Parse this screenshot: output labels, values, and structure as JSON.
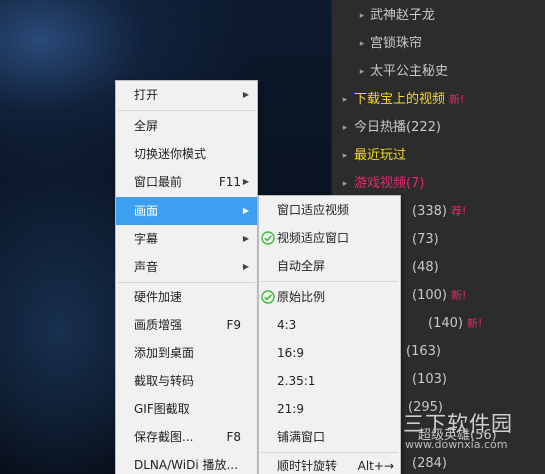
{
  "playlist": {
    "items": [
      {
        "text": "武神赵子龙",
        "badge": "",
        "style": "child"
      },
      {
        "text": "宫锁珠帘",
        "badge": "",
        "style": "child"
      },
      {
        "text": "太平公主秘史",
        "badge": "",
        "style": "child"
      },
      {
        "text": "下载宝上的视频",
        "badge": "新!",
        "style": "root-yellow"
      },
      {
        "text": "今日热播(222)",
        "badge": "",
        "style": "root-gray"
      },
      {
        "text": "最近玩过",
        "badge": "",
        "style": "root-yellow"
      },
      {
        "text": "游戏视频(7)",
        "badge": "",
        "style": "root-pink"
      },
      {
        "text": "(338)",
        "badge": "荐!",
        "style": "partial"
      },
      {
        "text": "(73)",
        "badge": "",
        "style": "partial"
      },
      {
        "text": "(48)",
        "badge": "",
        "style": "partial"
      },
      {
        "text": "(100)",
        "badge": "新!",
        "style": "partial"
      },
      {
        "text": "(140)",
        "badge": "新!",
        "style": "partial"
      },
      {
        "text": "(163)",
        "badge": "",
        "style": "partial"
      },
      {
        "text": "(103)",
        "badge": "",
        "style": "partial"
      },
      {
        "text": "(295)",
        "badge": "",
        "style": "partial"
      },
      {
        "text": "(56)",
        "badge": "",
        "style": "partial"
      },
      {
        "text": "(284)",
        "badge": "",
        "style": "partial"
      }
    ]
  },
  "main_menu": {
    "items": [
      {
        "label": "打开",
        "shortcut": "",
        "submenu": true
      },
      {
        "label": "全屏",
        "shortcut": "",
        "submenu": false
      },
      {
        "label": "切换迷你模式",
        "shortcut": "",
        "submenu": false
      },
      {
        "label": "窗口最前",
        "shortcut": "F11",
        "submenu": true
      },
      {
        "label": "画面",
        "shortcut": "",
        "submenu": true
      },
      {
        "label": "字幕",
        "shortcut": "",
        "submenu": true
      },
      {
        "label": "声音",
        "shortcut": "",
        "submenu": true
      },
      {
        "label": "硬件加速",
        "shortcut": "",
        "submenu": false
      },
      {
        "label": "画质增强",
        "shortcut": "F9",
        "submenu": false
      },
      {
        "label": "添加到桌面",
        "shortcut": "",
        "submenu": false
      },
      {
        "label": "截取与转码",
        "shortcut": "",
        "submenu": false
      },
      {
        "label": "GIF图截取",
        "shortcut": "",
        "submenu": false
      },
      {
        "label": "保存截图...",
        "shortcut": "F8",
        "submenu": false
      },
      {
        "label": "DLNA/WiDi 播放...",
        "shortcut": "",
        "submenu": false
      }
    ]
  },
  "sub_menu": {
    "items": [
      {
        "label": "窗口适应视频",
        "checked": false
      },
      {
        "label": "视频适应窗口",
        "checked": true
      },
      {
        "label": "自动全屏",
        "checked": false
      },
      {
        "label": "原始比例",
        "checked": true
      },
      {
        "label": "4:3",
        "checked": false
      },
      {
        "label": "16:9",
        "checked": false
      },
      {
        "label": "2.35:1",
        "checked": false
      },
      {
        "label": "21:9",
        "checked": false
      },
      {
        "label": "铺满窗口",
        "checked": false
      },
      {
        "label": "顺时针旋转",
        "shortcut": "Alt+→",
        "checked": false
      }
    ]
  },
  "watermark": {
    "title": "三下软件园",
    "url": "www.downxia.com",
    "overlay_text": "超级英雄"
  },
  "colors": {
    "menu_highlight": "#3c9ff0",
    "check_green": "#3cbf3c",
    "playlist_yellow": "#f2d82b",
    "playlist_pink": "#e6276f"
  }
}
